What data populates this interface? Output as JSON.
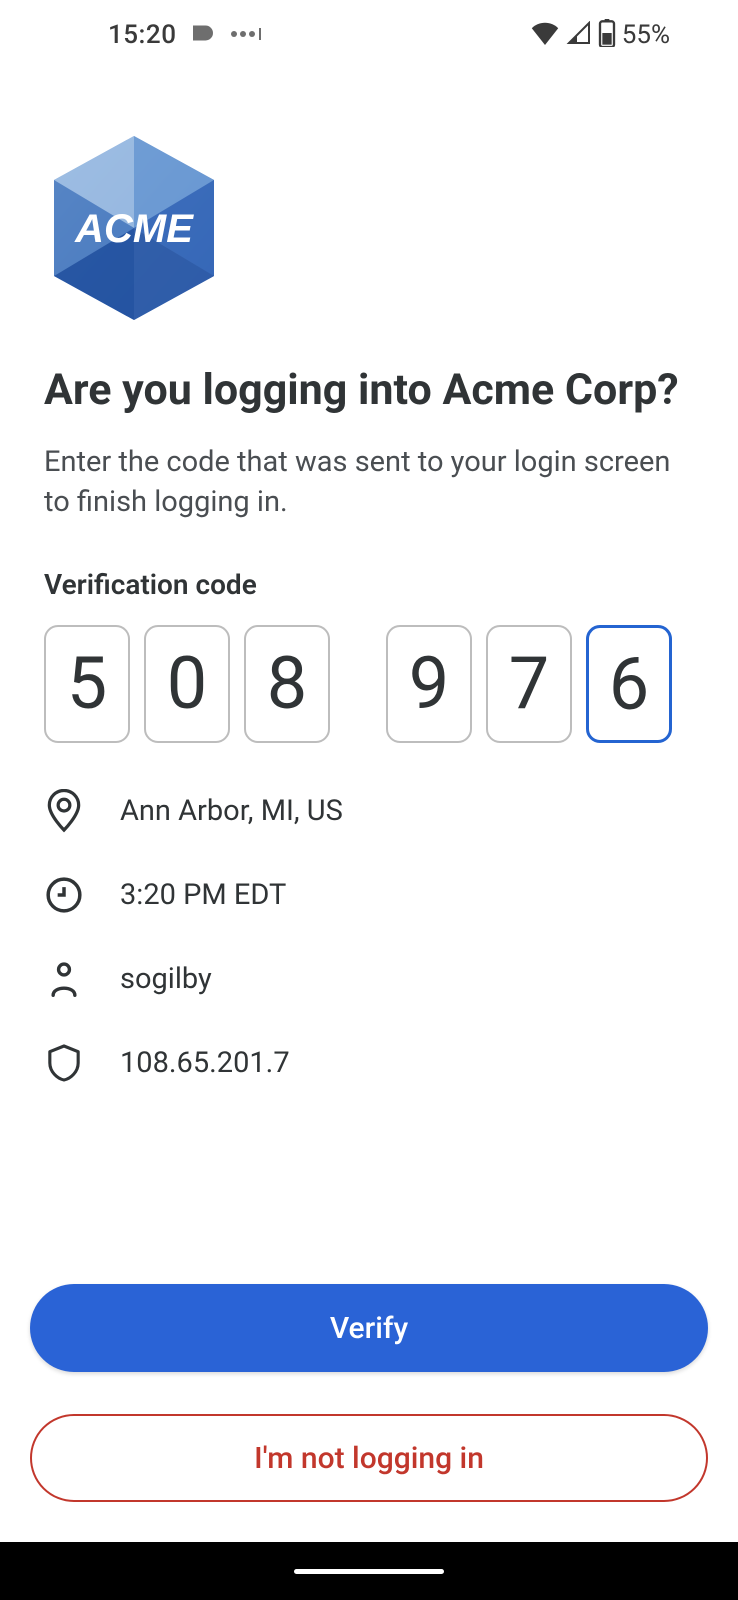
{
  "statusBar": {
    "time": "15:20",
    "battery": "55%"
  },
  "logo": {
    "text": "ACME"
  },
  "heading": "Are you logging into Acme Corp?",
  "description": "Enter the code that was sent to your login screen to finish logging in.",
  "codeLabel": "Verification code",
  "code": [
    "5",
    "0",
    "8",
    "9",
    "7",
    "6"
  ],
  "details": {
    "location": "Ann Arbor, MI, US",
    "time": "3:20 PM EDT",
    "user": "sogilby",
    "ip": "108.65.201.7"
  },
  "buttons": {
    "verify": "Verify",
    "deny": "I'm not logging in"
  }
}
